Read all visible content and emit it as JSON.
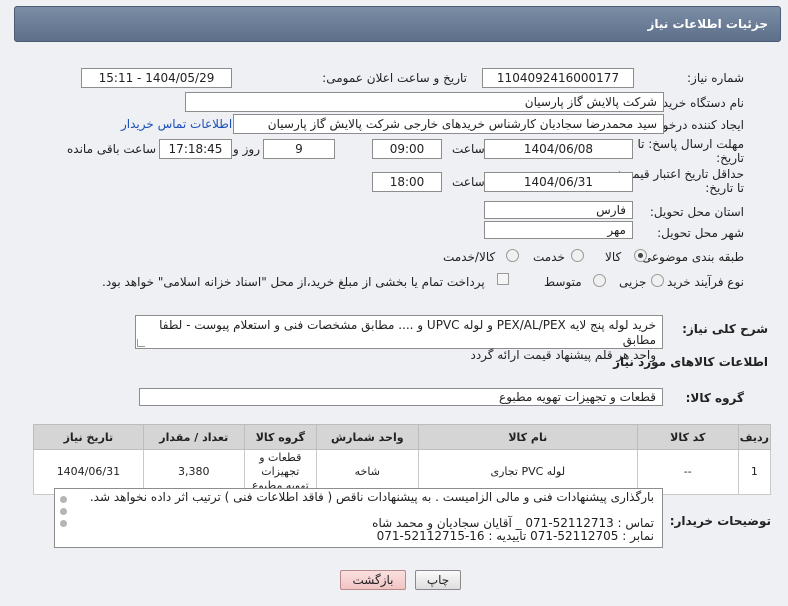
{
  "header": {
    "title": "جزئیات اطلاعات نیاز"
  },
  "form": {
    "need_number_label": "شماره نیاز:",
    "need_number": "1104092416000177",
    "announce_label": "تاریخ و ساعت اعلان عمومی:",
    "announce_value": "1404/05/29 - 15:11",
    "buyer_label": "نام دستگاه خریدار:",
    "buyer_value": "شرکت پالایش گاز پارسیان",
    "creator_label": "ایجاد کننده درخواست:",
    "creator_value": "سید محمدرضا سجادیان کارشناس خریدهای خارجی شرکت پالایش گاز پارسیان",
    "contact_link": "اطلاعات تماس خریدار",
    "deadline_label_1": "مهلت ارسال پاسخ: تا",
    "deadline_label_2": "تاریخ:",
    "deadline_date": "1404/06/08",
    "time_label": "ساعت",
    "deadline_time": "09:00",
    "days_value": "9",
    "days_label": "روز و",
    "remaining_time": "17:18:45",
    "remaining_label": "ساعت باقی مانده",
    "validity_label_1": "حداقل تاریخ اعتبار قیمت:",
    "validity_label_2": "تا تاریخ:",
    "validity_date": "1404/06/31",
    "validity_time": "18:00",
    "province_label": "استان محل تحویل:",
    "province_value": "فارس",
    "city_label": "شهر محل تحویل:",
    "city_value": "مهر",
    "category_label": "طبقه بندی موضوعی:",
    "category_options": [
      "کالا",
      "خدمت",
      "کالا/خدمت"
    ],
    "category_selected": "کالا",
    "process_label": "نوع فرآیند خرید :",
    "process_options": [
      "جزیی",
      "متوسط"
    ],
    "process_selected": "جزیی",
    "payment_note": "پرداخت تمام یا بخشی از مبلغ خرید،از محل \"اسناد خزانه اسلامی\" خواهد بود."
  },
  "description": {
    "label": "شرح کلی نیاز:",
    "line1": "خرید لوله پنج لایه PEX/AL/PEX و لوله  UPVC  و .... مطابق مشخصات فنی و استعلام پیوست - لطفا مطابق",
    "line2": "واحد هر قلم پیشنهاد قیمت ارائه گردد"
  },
  "goods": {
    "section_title": "اطلاعات کالاهای مورد نیاز",
    "group_label": "گروه کالا:",
    "group_value": "قطعات و تجهیزات تهویه مطبوع",
    "columns": [
      "ردیف",
      "کد کالا",
      "نام کالا",
      "واحد شمارش",
      "گروه کالا",
      "تعداد / مقدار",
      "تاریخ نیاز"
    ],
    "rows": [
      {
        "row": "1",
        "code": "--",
        "name": "لوله PVC تجاری",
        "unit": "شاخه",
        "group_line1": "قطعات و تجهیزات",
        "group_line2": "تهویه مطبوع",
        "qty": "3,380",
        "date": "1404/06/31"
      }
    ]
  },
  "notes": {
    "label": "توضیحات خریدار:",
    "line1": "بارگذاری پیشنهادات فنی و مالی الزامیست . به پیشنهادات ناقص ( فاقد اطلاعات فنی ) ترتیب اثر داده نخواهد شد.",
    "line2": "",
    "line3": "تماس : 52112713-071 _ آقایان سجادیان و محمد شاه",
    "line4": "نمابر : 52112705-071 تاییدیه : 16-52112715-071"
  },
  "buttons": {
    "print": "چاپ",
    "back": "بازگشت"
  }
}
